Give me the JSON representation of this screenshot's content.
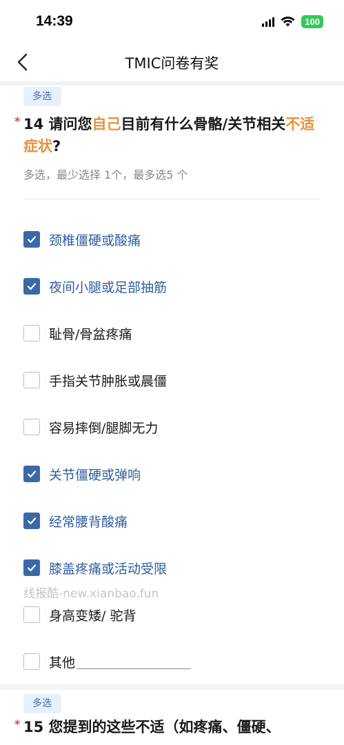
{
  "status_bar": {
    "time": "14:39",
    "battery": "100"
  },
  "nav": {
    "title": "TMIC问卷有奖"
  },
  "question14": {
    "tag": "多选",
    "required_mark": "*",
    "title_part1": "14 请问您",
    "title_hl1": "自己",
    "title_part2": "目前有什么骨骼/关节相关",
    "title_hl2": "不适症状",
    "title_part3": "?",
    "hint": "多选，最少选择 1个，最多选5 个",
    "options": [
      {
        "label": "颈椎僵硬或酸痛",
        "checked": true
      },
      {
        "label": "夜间小腿或足部抽筋",
        "checked": true
      },
      {
        "label": "耻骨/骨盆疼痛",
        "checked": false
      },
      {
        "label": "手指关节肿胀或晨僵",
        "checked": false
      },
      {
        "label": "容易摔倒/腿脚无力",
        "checked": false
      },
      {
        "label": "关节僵硬或弹响",
        "checked": true
      },
      {
        "label": "经常腰背酸痛",
        "checked": true
      },
      {
        "label": "膝盖疼痛或活动受限",
        "checked": true
      },
      {
        "label": "身高变矮/ 驼背",
        "checked": false
      },
      {
        "label": "其他",
        "checked": false
      }
    ],
    "watermark": "线报酷-new.xianbao.fun"
  },
  "question15": {
    "tag": "多选",
    "required_mark": "*",
    "title": "15 您提到的这些不适（如疼痛、僵硬、"
  },
  "colors": {
    "accent": "#3b69a8",
    "highlight": "#e8913a",
    "required": "#e0433b",
    "tag_bg": "#e8f0fb"
  }
}
